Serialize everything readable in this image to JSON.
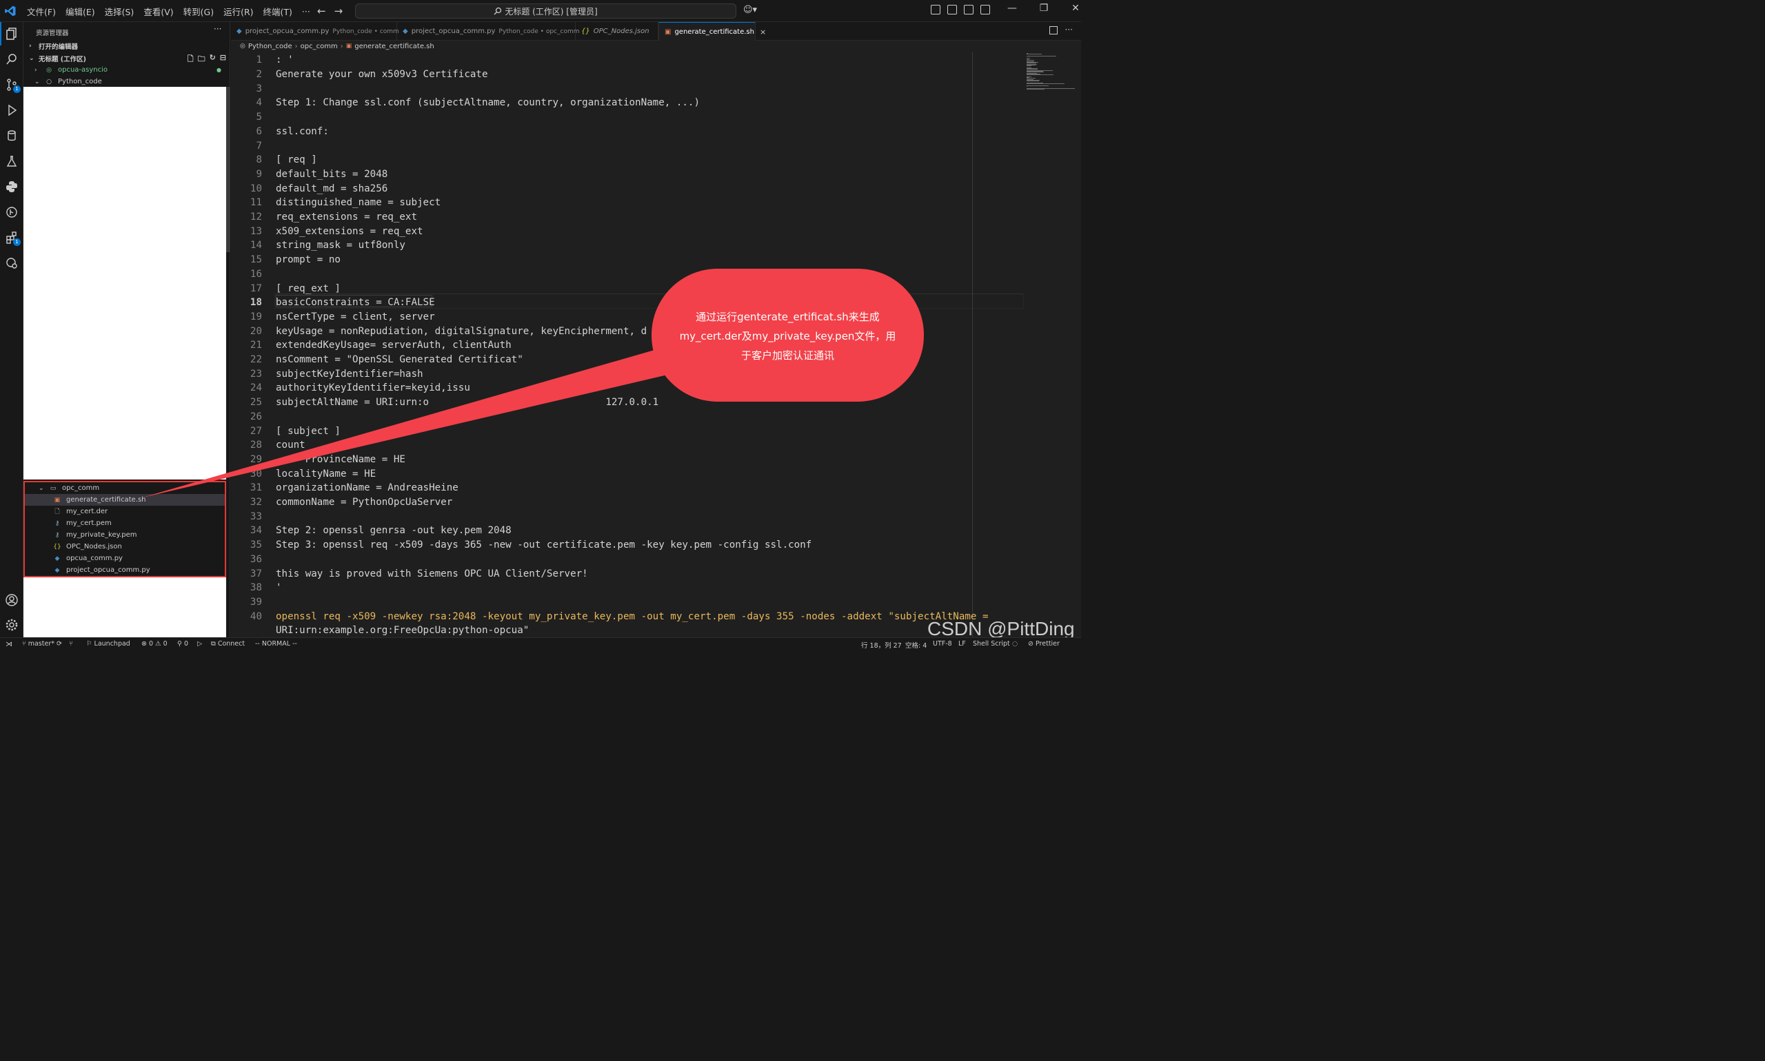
{
  "menu": [
    "文件(F)",
    "编辑(E)",
    "选择(S)",
    "查看(V)",
    "转到(G)",
    "运行(R)",
    "终端(T)",
    "···"
  ],
  "command_center": "无标题 (工作区) [管理员]",
  "activity_badges": {
    "source_control": "1",
    "extensions": "1"
  },
  "sidebar": {
    "title": "资源管理器",
    "more": "···",
    "open_editors": "打开的编辑器",
    "workspace": "无标题 (工作区)",
    "folders": [
      {
        "name": "opcua-asyncio"
      },
      {
        "name": "Python_code"
      }
    ],
    "subfolder": "opc_comm",
    "files": [
      {
        "name": "generate_certificate.sh",
        "icon": "shell-icon"
      },
      {
        "name": "my_cert.der",
        "icon": "file-icon"
      },
      {
        "name": "my_cert.pem",
        "icon": "key-icon"
      },
      {
        "name": "my_private_key.pem",
        "icon": "key-icon"
      },
      {
        "name": "OPC_Nodes.json",
        "icon": "json-icon"
      },
      {
        "name": "opcua_comm.py",
        "icon": "python-icon"
      },
      {
        "name": "project_opcua_comm.py",
        "icon": "python-icon"
      }
    ]
  },
  "tabs": [
    {
      "label": "project_opcua_comm.py",
      "desc": "Python_code • comm"
    },
    {
      "label": "project_opcua_comm.py",
      "desc": "Python_code • opc_comm"
    },
    {
      "label": "OPC_Nodes.json",
      "desc": ""
    },
    {
      "label": "generate_certificate.sh",
      "desc": "",
      "close": "×"
    }
  ],
  "breadcrumb": [
    "Python_code",
    "opc_comm",
    "generate_certificate.sh"
  ],
  "code_lines": [
    ": '",
    "Generate your own x509v3 Certificate",
    "",
    "Step 1: Change ssl.conf (subjectAltname, country, organizationName, ...)",
    "",
    "ssl.conf:",
    "",
    "[ req ]",
    "default_bits = 2048",
    "default_md = sha256",
    "distinguished_name = subject",
    "req_extensions = req_ext",
    "x509_extensions = req_ext",
    "string_mask = utf8only",
    "prompt = no",
    "",
    "[ req_ext ]",
    "basicConstraints = CA:FALSE",
    "nsCertType = client, server",
    "keyUsage = nonRepudiation, digitalSignature, keyEncipherment, d",
    "extendedKeyUsage= serverAuth, clientAuth",
    "nsComment = \"OpenSSL Generated Certificat\"",
    "subjectKeyIdentifier=hash",
    "authorityKeyIdentifier=keyid,issu",
    "subjectAltName = URI:urn:o                              127.0.0.1",
    "",
    "[ subject ]",
    "count",
    "     ProvinceName = HE",
    "localityName = HE",
    "organizationName = AndreasHeine",
    "commonName = PythonOpcUaServer",
    "",
    "Step 2: openssl genrsa -out key.pem 2048",
    "Step 3: openssl req -x509 -days 365 -new -out certificate.pem -key key.pem -config ssl.conf",
    "",
    "this way is proved with Siemens OPC UA Client/Server!",
    "'",
    "",
    "openssl req -x509 -newkey rsa:2048 -keyout my_private_key.pem -out my_cert.pem -days 355 -nodes -addext \"subjectAltName =",
    "URI:urn:example.org:FreeOpcUa:python-opcua\""
  ],
  "line_numbers": [
    "1",
    "2",
    "3",
    "4",
    "5",
    "6",
    "7",
    "8",
    "9",
    "10",
    "11",
    "12",
    "13",
    "14",
    "15",
    "16",
    "17",
    "18",
    "19",
    "20",
    "21",
    "22",
    "23",
    "24",
    "25",
    "26",
    "27",
    "28",
    "29",
    "30",
    "31",
    "32",
    "33",
    "34",
    "35",
    "36",
    "37",
    "38",
    "39",
    "40",
    ""
  ],
  "current_line": 18,
  "callout": {
    "text": "通过运行genterate_ertificat.sh来生成my_cert.der及my_private_key.pen文件，用于客户加密认证通讯",
    "color": "#f2414a"
  },
  "watermark": "CSDN @PittDing",
  "status": {
    "branch": "master*",
    "launchpad": "Launchpad",
    "errors": "0",
    "warnings": "0",
    "ports": "0",
    "connect": "Connect",
    "mode": "-- NORMAL --",
    "position": "行 18，列 27",
    "spaces": "空格: 4",
    "encoding": "UTF-8",
    "eol": "LF",
    "language": "Shell Script",
    "prettier": "Prettier"
  },
  "colors": {
    "accent": "#0078d4",
    "callout": "#f2414a",
    "selection_border": "#e53935"
  }
}
